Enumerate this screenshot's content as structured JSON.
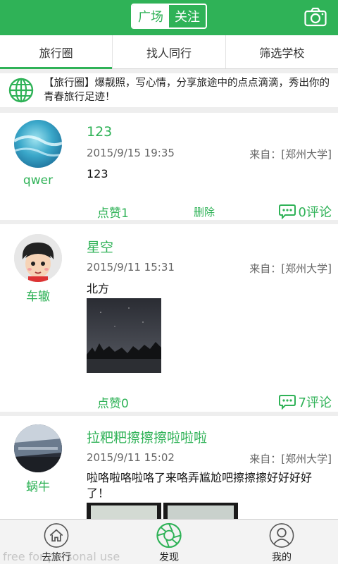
{
  "header": {
    "seg_plaza": "广场",
    "seg_follow": "关注",
    "accent": "#2fb257"
  },
  "tabs": [
    {
      "label": "旅行圈"
    },
    {
      "label": "找人同行"
    },
    {
      "label": "筛选学校"
    }
  ],
  "notice": {
    "text": "【旅行圈】爆靓照，写心情，分享旅途中的点点滴滴，秀出你的青春旅行足迹！"
  },
  "posts": [
    {
      "nick": "qwer",
      "title": "123",
      "time": "2015/9/15 19:35",
      "from": "来自：[郑州大学]",
      "body": "123",
      "like": "点赞1",
      "delete": "删除",
      "comments": "0评论"
    },
    {
      "nick": "车辙",
      "title": "星空",
      "time": "2015/9/11 15:31",
      "from": "来自：[郑州大学]",
      "body": "北方",
      "like": "点赞0",
      "comments": "7评论"
    },
    {
      "nick": "蜗牛",
      "title": "拉粑粑擦擦擦啦啦啦",
      "time": "2015/9/11 15:02",
      "from": "来自：[郑州大学]",
      "body": "啦咯啦咯啦咯了来咯弄尴尬吧擦擦擦好好好好了！"
    }
  ],
  "bottom_nav": [
    {
      "label": "去旅行",
      "icon": "home-icon"
    },
    {
      "label": "发现",
      "icon": "aperture-icon"
    },
    {
      "label": "我的",
      "icon": "user-icon"
    }
  ],
  "watermark": "free for personal use"
}
